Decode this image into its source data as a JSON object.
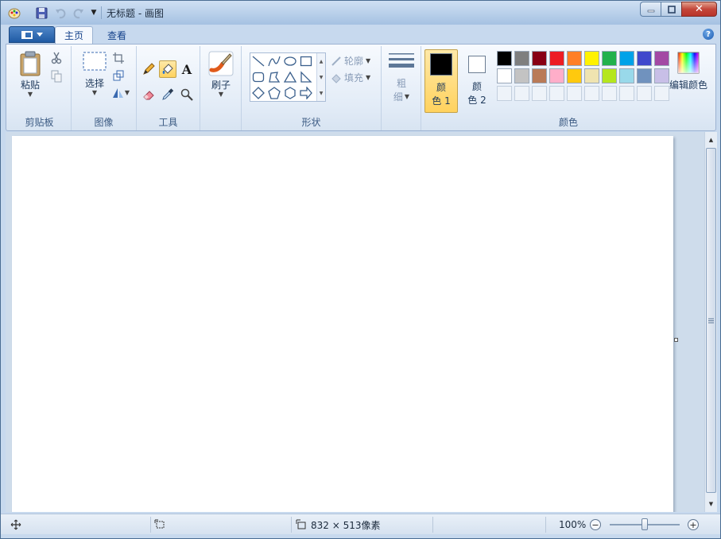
{
  "window": {
    "title": "无标题 - 画图"
  },
  "tabs": {
    "home": "主页",
    "view": "查看"
  },
  "clipboard": {
    "paste_label": "粘贴",
    "group_label": "剪贴板"
  },
  "image": {
    "select_label": "选择",
    "group_label": "图像"
  },
  "tools": {
    "group_label": "工具",
    "text_tool_glyph": "A"
  },
  "brushes": {
    "label": "刷子"
  },
  "shapes": {
    "group_label": "形状",
    "outline_label": "轮廓",
    "fill_label": "填充"
  },
  "size": {
    "label_line1": "粗",
    "label_line2": "细"
  },
  "colors": {
    "group_label": "颜色",
    "color1_line1": "颜",
    "color1_line2": "色 1",
    "color2_line1": "颜",
    "color2_line2": "色 2",
    "color1_value": "#000000",
    "color2_value": "#ffffff",
    "edit_label": "编辑颜色",
    "palette_row1": [
      "#000000",
      "#7f7f7f",
      "#880015",
      "#ed1c24",
      "#ff7f27",
      "#fff200",
      "#22b14c",
      "#00a2e8",
      "#3f48cc",
      "#a349a4"
    ],
    "palette_row2": [
      "#ffffff",
      "#c3c3c3",
      "#b97a57",
      "#ffaec9",
      "#ffc90e",
      "#efe4b0",
      "#b5e61d",
      "#99d9ea",
      "#7092be",
      "#c8bfe7"
    ]
  },
  "status": {
    "dimensions": "832 × 513像素",
    "zoom": "100%"
  }
}
